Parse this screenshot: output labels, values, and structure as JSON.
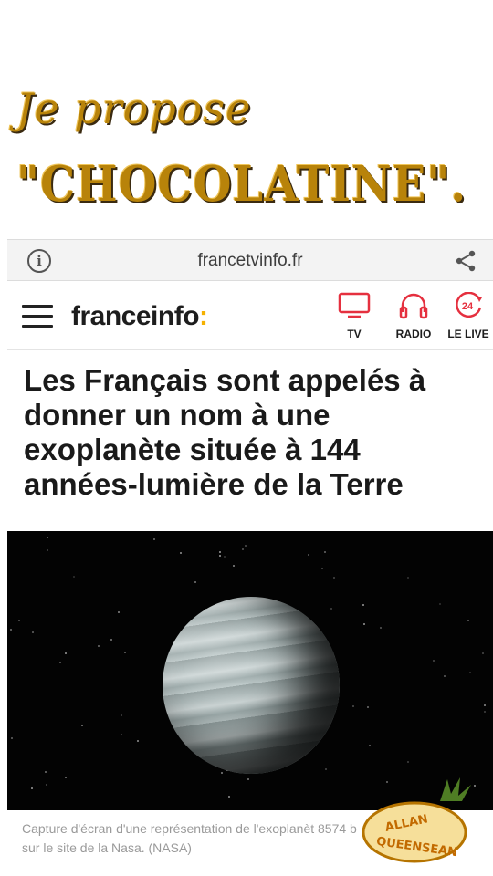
{
  "meme": {
    "line1": "Je propose",
    "line2": "\"CHOCOLATINE\"."
  },
  "browser": {
    "url": "francetvinfo.fr",
    "info_icon": "info-icon",
    "share_icon": "share-icon"
  },
  "header": {
    "logo": "franceinfo",
    "logo_colon": ":",
    "nav": [
      {
        "label": "TV",
        "icon": "tv-icon"
      },
      {
        "label": "RADIO",
        "icon": "headphones-icon"
      },
      {
        "label": "LE LIVE",
        "icon": "live-24-icon",
        "badge": "24"
      }
    ],
    "accent_color": "#e5303f"
  },
  "article": {
    "headline": "Les Français sont appelés à donner un nom à une exoplanète située à 144 années-lumière de la Terre",
    "image_credit": "Capture d'écran d'une représentation de l'exoplanèt 8574 b sur le site de la Nasa.  (NASA)"
  },
  "watermark": {
    "line1": "ALLAN",
    "line2": "QUEENSEAN"
  }
}
